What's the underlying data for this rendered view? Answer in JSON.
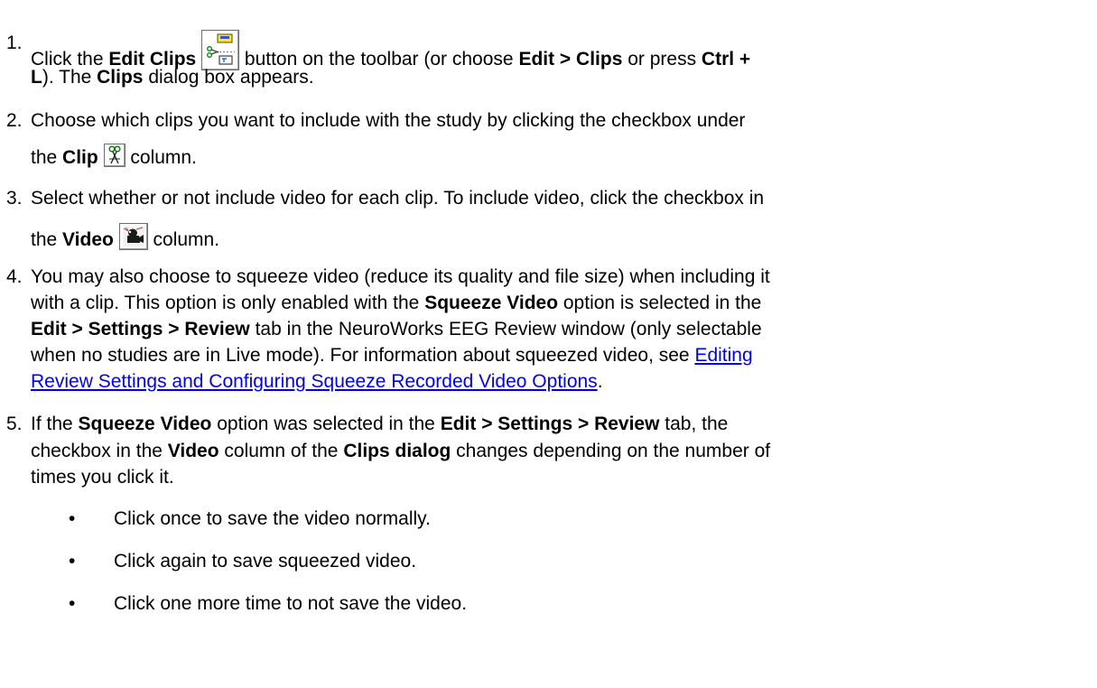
{
  "steps": [
    {
      "num": "1.",
      "a": "Click the ",
      "b1": "Edit Clips",
      "c": " button on the toolbar (or choose ",
      "b2": "Edit > Clips",
      "d": " or press ",
      "b3": "Ctrl +",
      "b4": "L",
      "e": "). The ",
      "b5": "Clips",
      "f": " dialog box appears."
    },
    {
      "num": "2.",
      "a": "Choose which clips you want to include with the study by clicking the checkbox under",
      "b": "the ",
      "b1": "Clip",
      "c": " column."
    },
    {
      "num": "3.",
      "a": "Select whether or not include video for each clip. To include video, click the checkbox in",
      "b": "the ",
      "b1": "Video",
      "c": " column."
    },
    {
      "num": "4.",
      "a": "You may also choose to squeeze video (reduce its quality and file size) when including it",
      "b": "with a clip. This option is only enabled with the ",
      "b1": "Squeeze Video",
      "c": " option is selected in the",
      "b2": "Edit > Settings > Review",
      "d": " tab in the NeuroWorks EEG Review window (only selectable",
      "e": "when no studies are in Live mode). For information about squeezed video, see ",
      "link1": "Editing",
      "link2": "Review Settings and Configuring Squeeze Recorded Video Options",
      "f": "."
    },
    {
      "num": "5.",
      "a": "If the ",
      "b1": "Squeeze Video",
      "c": " option was selected in the ",
      "b2": "Edit > Settings > Review",
      "d": " tab, the",
      "e": "checkbox in the ",
      "b3": "Video",
      "f": " column of the ",
      "b4": "Clips dialog",
      "g": " changes depending on the number of",
      "h": "times you click it."
    }
  ],
  "bullets": [
    "Click once to save the video normally.",
    "Click again to save squeezed video.",
    "Click one more time to not save the video."
  ],
  "bullet_char": "•",
  "icons": {
    "edit_clips": "edit-clips-icon",
    "clip": "scissors-icon",
    "video": "video-camera-icon"
  }
}
